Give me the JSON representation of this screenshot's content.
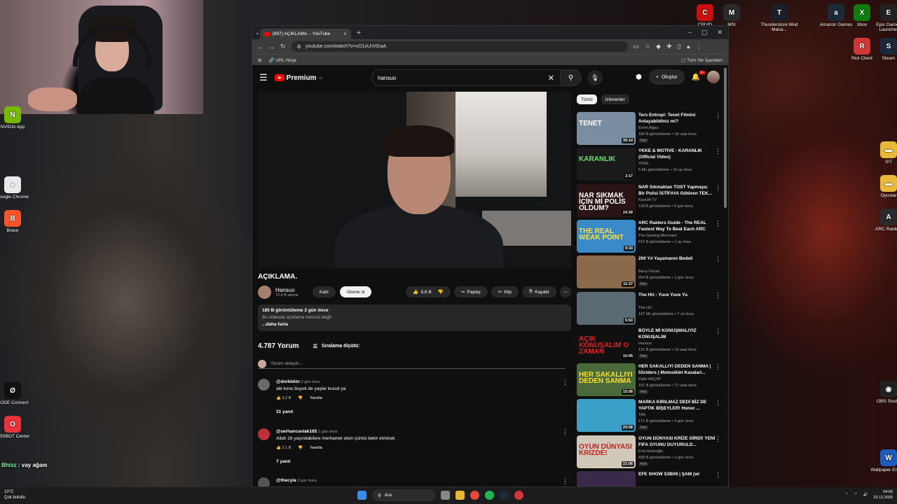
{
  "desktop": {
    "top_icons": [
      {
        "label": "CPUID",
        "color": "#c81010",
        "glyph": "C"
      },
      {
        "label": "MSI",
        "color": "#2a2a2a",
        "glyph": "M"
      },
      {
        "label": "Thunderstore Mod Mana...",
        "color": "#1a1f2a",
        "glyph": "T"
      },
      {
        "label": "Amazon Games",
        "color": "#1a2a38",
        "glyph": "a"
      },
      {
        "label": "Xbox",
        "color": "#107c10",
        "glyph": "X"
      },
      {
        "label": "Epic Games Launcher",
        "color": "#222",
        "glyph": "E"
      }
    ],
    "right_icons": [
      {
        "label": "Riot Client",
        "color": "#d13639",
        "glyph": "R"
      },
      {
        "label": "Steam",
        "color": "#1b2838",
        "glyph": "S"
      },
      {
        "label": "SIT",
        "color": "#e8b838",
        "glyph": "▬"
      },
      {
        "label": "Oyunlar",
        "color": "#e8b838",
        "glyph": "▬"
      },
      {
        "label": "ARC Raiders",
        "color": "#2a2a2a",
        "glyph": "A"
      },
      {
        "label": "OBS Studio",
        "color": "#222",
        "glyph": "◉"
      },
      {
        "label": "Wallpaper Engine",
        "color": "#1e5ab8",
        "glyph": "W"
      }
    ],
    "left_icons": [
      {
        "label": "NVIDIA App",
        "color": "#76b900",
        "glyph": "N"
      },
      {
        "label": "Google Chrome",
        "color": "#e8e8e8",
        "glyph": "●"
      },
      {
        "label": "Brave",
        "color": "#fb542b",
        "glyph": "B"
      },
      {
        "label": "RODE Connect",
        "color": "#111",
        "glyph": "Ø"
      },
      {
        "label": "OBSBOT Center",
        "color": "#e8323c",
        "glyph": "O"
      }
    ]
  },
  "chat": {
    "user": "Bhtsz",
    "message": "vay ağam"
  },
  "browser": {
    "tab_title": "(897) AÇIKLAMA. - YouTube",
    "url": "youtube.com/watch?v=vO1vLhV0raA",
    "bookmark": "URL Ninja",
    "all_bookmarks": "Tüm Yer İşaretleri"
  },
  "youtube": {
    "logo": "Premium",
    "logo_sup": "TR",
    "search_value": "hansuo",
    "create_label": "Oluştur",
    "notif_badge": "9+",
    "video_title": "AÇIKLAMA.",
    "channel": {
      "name": "Hansuo",
      "subs": "72,6 B abone"
    },
    "join_label": "Katıl",
    "subscribe_label": "Abone ol",
    "likes": "5,6 B",
    "share_label": "Paylaş",
    "clip_label": "Klip",
    "save_label": "Kaydet",
    "desc_stats": "185 B görüntüleme  2 gün önce",
    "desc_text": "Bu videoda açıklama mevcut değil.",
    "desc_more": "...daha fazla",
    "comment_count": "4.787 Yorum",
    "sort_label": "Sıralama ölçütü:",
    "add_comment": "Yorum ekleyin...",
    "reply_label": "Yanıtla",
    "comments": [
      {
        "author": "@dorkkktn",
        "time": "2 gün önce",
        "text": "abi konu buyuk de yaşlar kucuk ya",
        "likes": "3,2 B",
        "replies": "31 yanıt",
        "avatar": "#6a6a6a"
      },
      {
        "author": "@serhancavlak165",
        "time": "2 gün önce",
        "text": "Allah 16 yaşındakilere merhamet etsin çünkü bekir etmicek",
        "likes": "2,1 B",
        "replies": "7 yanıt",
        "avatar": "#c0303a"
      },
      {
        "author": "@thecyla",
        "time": "2 gün önce",
        "text": "",
        "likes": "",
        "replies": "",
        "avatar": "#555"
      }
    ],
    "chips": [
      "Tümü",
      "İzlenenler"
    ],
    "recommended": [
      {
        "title": "Ters Entropi: Tenet Filmini Anlayabildiniz mi?",
        "channel": "Evrim Ağacı",
        "meta": "180 B görüntüleme • 18 saat önce",
        "new": "Yeni",
        "duration": "35:14",
        "thumb": "TENET",
        "bg": "#7a8ca0",
        "fg": "#fff"
      },
      {
        "title": "YKKE & MOTIVE - KARANLIK (Official Video)",
        "channel": "YKKE",
        "meta": "5 Mn görüntüleme • 10 ay önce",
        "new": "",
        "duration": "3:17",
        "thumb": "KARANLIK",
        "bg": "#1a1a1a",
        "fg": "#6fe06f"
      },
      {
        "title": "NAR Sıkmaktan TOST Yapmaya: Bir Polisi İSTİFAYA Götüren TEK...",
        "channel": "Kare34 TV",
        "meta": "118 B görüntüleme • 9 gün önce",
        "new": "",
        "duration": "24:39",
        "thumb": "NAR SIKMAK İÇİN Mİ POLİS OLDUM?",
        "bg": "#2a1414",
        "fg": "#fff"
      },
      {
        "title": "ARC Raiders Guide - The REAL Fastest Way To Beat Each ARC",
        "channel": "The Gaming Merchant",
        "meta": "672 B görüntüleme • 1 ay önce",
        "new": "",
        "duration": "9:33",
        "thumb": "THE REAL WEAK POINT",
        "bg": "#3a8ac8",
        "fg": "#ffe040"
      },
      {
        "title": "200 Yıl Yaşamanın Bedeli",
        "channel": "Barış Özcan",
        "meta": "204 B görüntüleme • 1 gün önce",
        "new": "Yeni",
        "duration": "11:37",
        "thumb": "",
        "bg": "#8a6a4a",
        "fg": "#fff"
      },
      {
        "title": "The HU - Yuve Yuve Yu",
        "channel": "The HU",
        "meta": "137 Mn görüntüleme • 7 yıl önce",
        "new": "",
        "duration": "5:53",
        "thumb": "",
        "bg": "#5a6a72",
        "fg": "#fff"
      },
      {
        "title": "BÖYLE Mİ KONUŞMALIYIZ KONUŞALIM",
        "channel": "Hansuo",
        "meta": "131 B görüntüleme • 13 saat önce",
        "new": "Yeni",
        "duration": "10:05",
        "thumb": "AÇIK KONUŞALIM O ZAMAN",
        "bg": "#101010",
        "fg": "#e02020"
      },
      {
        "title": "HER SAKALLIYI DEDEN SANMA | 5Sriders | Motosiklet Kazalari...",
        "channel": "Zafer AKÇAY",
        "meta": "101 B görüntüleme • 17 saat önce",
        "new": "Yeni",
        "duration": "15:08",
        "thumb": "HER SAKALLIYI DEDEN SANMA",
        "bg": "#4a6a3a",
        "fg": "#ffe020"
      },
      {
        "title": "MARKA KIRILMAZ DEDİ BİZ DE YAPTIK BİŞEYLER! Honor ...",
        "channel": "TAA",
        "meta": "171 B görüntüleme • 4 gün önce",
        "new": "Yeni",
        "duration": "29:58",
        "thumb": "",
        "bg": "#3aa0c8",
        "fg": "#fff"
      },
      {
        "title": "OYUN DÜNYASI KRİZE GİRDİ! YENİ FIFA OYUNU DUYURULD...",
        "channel": "Enis Kirazoğlu",
        "meta": "438 B görüntüleme • 2 gün önce",
        "new": "Yeni",
        "duration": "21:06",
        "thumb": "OYUN DÜNYASI KRİZDE!",
        "bg": "#d0c8b8",
        "fg": "#c02020"
      },
      {
        "title": "EFE SHOW S3B09 | ŞAM (w/",
        "channel": "",
        "meta": "",
        "new": "",
        "duration": "",
        "thumb": "",
        "bg": "#3a2a4a",
        "fg": "#fff"
      }
    ]
  },
  "taskbar": {
    "weather_temp": "10°C",
    "weather_text": "Çok bulutlu",
    "search": "Ara",
    "time": "04:05",
    "date": "22.12.2025"
  }
}
